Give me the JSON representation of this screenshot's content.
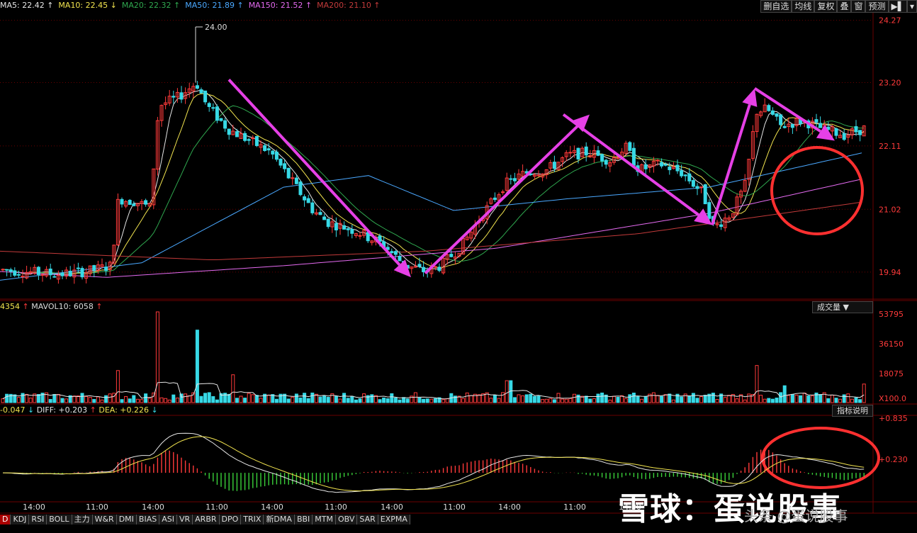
{
  "ma_legend": [
    {
      "label": "MA5: 22.42",
      "color": "#e6e6e6",
      "arrow": "↑"
    },
    {
      "label": "MA10: 22.45",
      "color": "#f2e44f",
      "arrow": "↓"
    },
    {
      "label": "MA20: 22.32",
      "color": "#2fa84f",
      "arrow": "↑"
    },
    {
      "label": "MA50: 21.89",
      "color": "#4aa8ff",
      "arrow": "↑"
    },
    {
      "label": "MA150: 21.52",
      "color": "#e46af0",
      "arrow": "↑"
    },
    {
      "label": "MA200: 21.10",
      "color": "#c23a3a",
      "arrow": "↑"
    }
  ],
  "toolbar": [
    "删自选",
    "均线",
    "复权",
    "叠",
    "窗",
    "预测",
    "▶▌",
    "▾"
  ],
  "price_axis": [
    "24.27",
    "23.20",
    "22.11",
    "21.02",
    "19.94"
  ],
  "peak_label": "24.00",
  "volume": {
    "legend_vol": "4354",
    "legend_mavol": "MAVOL10: 6058",
    "axis": [
      "53795",
      "36150",
      "18075"
    ],
    "unit": "X100.0",
    "button": "成交量 ▼"
  },
  "macd": {
    "macd": "-0.047",
    "diff": "DIFF: +0.203",
    "dea": "DEA: +0.226",
    "axis": [
      "+0.835",
      "+0.230"
    ],
    "button": "指标说明"
  },
  "time_axis": [
    "14:00",
    "11:00",
    "14:00",
    "11:00",
    "14:00",
    "11:00",
    "14:00",
    "11:00",
    "14:00",
    "11:00",
    "14:00"
  ],
  "tabs": [
    "D",
    "KDJ",
    "RSI",
    "BOLL",
    "主力",
    "W&R",
    "DMI",
    "BIAS",
    "ASI",
    "VR",
    "ARBR",
    "DPO",
    "TRIX",
    "新DMA",
    "BBI",
    "MTM",
    "OBV",
    "SAR",
    "EXPMA"
  ],
  "watermark": "雪球：蛋说股事",
  "watermark_sub": "头条 @蛋说股事",
  "colors": {
    "up": "#ff3a3a",
    "down": "#37d9e6",
    "arrow": "#e640e6",
    "circle": "#ff3030",
    "grid": "#6a0000"
  },
  "chart_data": {
    "type": "candlestick",
    "ylim": [
      19.5,
      24.4
    ],
    "price_anchors": [
      [
        0,
        19.98
      ],
      [
        40,
        19.94
      ],
      [
        80,
        19.9
      ],
      [
        120,
        19.95
      ],
      [
        155,
        20.05
      ],
      [
        165,
        21.2
      ],
      [
        190,
        21.15
      ],
      [
        210,
        21.05
      ],
      [
        222,
        22.8
      ],
      [
        250,
        22.95
      ],
      [
        275,
        23.2
      ],
      [
        290,
        22.8
      ],
      [
        320,
        22.4
      ],
      [
        350,
        22.2
      ],
      [
        380,
        22.0
      ],
      [
        410,
        21.5
      ],
      [
        440,
        21.0
      ],
      [
        460,
        20.8
      ],
      [
        500,
        20.65
      ],
      [
        540,
        20.4
      ],
      [
        570,
        20.05
      ],
      [
        600,
        19.95
      ],
      [
        620,
        20.05
      ],
      [
        650,
        20.4
      ],
      [
        680,
        20.95
      ],
      [
        710,
        21.45
      ],
      [
        740,
        21.65
      ],
      [
        770,
        21.7
      ],
      [
        800,
        21.95
      ],
      [
        830,
        22.0
      ],
      [
        860,
        21.85
      ],
      [
        880,
        22.1
      ],
      [
        900,
        21.7
      ],
      [
        930,
        21.8
      ],
      [
        960,
        21.65
      ],
      [
        990,
        21.3
      ],
      [
        1005,
        20.7
      ],
      [
        1030,
        20.95
      ],
      [
        1050,
        21.45
      ],
      [
        1065,
        22.7
      ],
      [
        1080,
        22.75
      ],
      [
        1100,
        22.45
      ],
      [
        1130,
        22.55
      ],
      [
        1160,
        22.4
      ],
      [
        1190,
        22.3
      ],
      [
        1220,
        22.42
      ]
    ],
    "ma_levels": {
      "MA50": [
        [
          0,
          19.8
        ],
        [
          200,
          20.1
        ],
        [
          400,
          21.4
        ],
        [
          520,
          21.6
        ],
        [
          640,
          21.0
        ],
        [
          800,
          21.2
        ],
        [
          1000,
          21.4
        ],
        [
          1220,
          22.0
        ]
      ],
      "MA150": [
        [
          0,
          19.95
        ],
        [
          150,
          19.85
        ],
        [
          400,
          20.05
        ],
        [
          700,
          20.35
        ],
        [
          1000,
          20.95
        ],
        [
          1220,
          21.55
        ]
      ],
      "MA200": [
        [
          0,
          20.3
        ],
        [
          300,
          20.15
        ],
        [
          600,
          20.3
        ],
        [
          900,
          20.6
        ],
        [
          1220,
          21.15
        ]
      ]
    },
    "arrows": [
      {
        "from": [
          323,
          23.25
        ],
        "to": [
          580,
          19.85
        ]
      },
      {
        "from": [
          600,
          19.92
        ],
        "to": [
          832,
          22.65
        ]
      },
      {
        "from": [
          795,
          22.65
        ],
        "to": [
          1005,
          20.75
        ]
      },
      {
        "from": [
          1005,
          20.75
        ],
        "to": [
          1065,
          23.1
        ]
      },
      {
        "from": [
          1065,
          23.1
        ],
        "to": [
          1178,
          22.2
        ]
      }
    ],
    "volume_ylim": [
      0,
      53795
    ],
    "macd_ylim": [
      -0.4,
      0.835
    ]
  }
}
